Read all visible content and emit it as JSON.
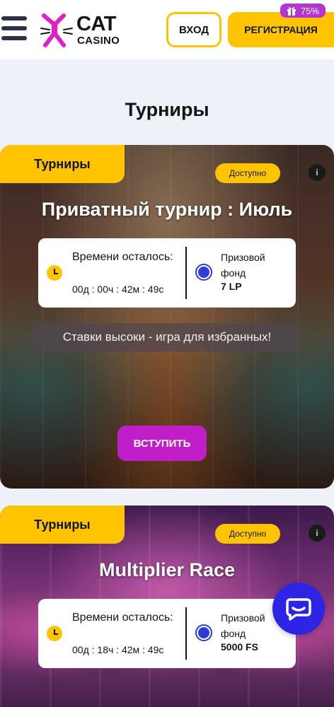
{
  "header": {
    "logo_top": "CAT",
    "logo_bottom": "CASINO",
    "login_label": "ВХОД",
    "register_label": "РЕГИСТРАЦИЯ",
    "bonus_percent": "75%"
  },
  "page_title": "Турниры",
  "tournaments": [
    {
      "tag": "Турниры",
      "status": "Доступно",
      "info_symbol": "i",
      "title": "Приватный турнир : Июль",
      "time_label": "Времени осталось:",
      "time_value": "00д : 00ч : 42м : 49с",
      "prize_label": "Призовой фонд",
      "prize_value": "7 LP",
      "slogan": "Ставки высоки - игра для избранных!",
      "join_label": "ВСТУПИТЬ"
    },
    {
      "tag": "Турниры",
      "status": "Доступно",
      "info_symbol": "i",
      "title": "Multiplier Race",
      "time_label": "Времени осталось:",
      "time_value": "00д : 18ч : 42м : 49с",
      "prize_label": "Призовой фонд",
      "prize_value": "5000 FS"
    }
  ],
  "colors": {
    "accent_yellow": "#ffc400",
    "join_purple": "#c01ec8",
    "chat_blue": "#2d24e6",
    "bonus_purple": "#b534d4"
  },
  "icons": [
    "menu-icon",
    "cat-logo-icon",
    "gift-icon",
    "clock-icon",
    "prize-coin-icon",
    "info-icon",
    "chat-icon"
  ]
}
